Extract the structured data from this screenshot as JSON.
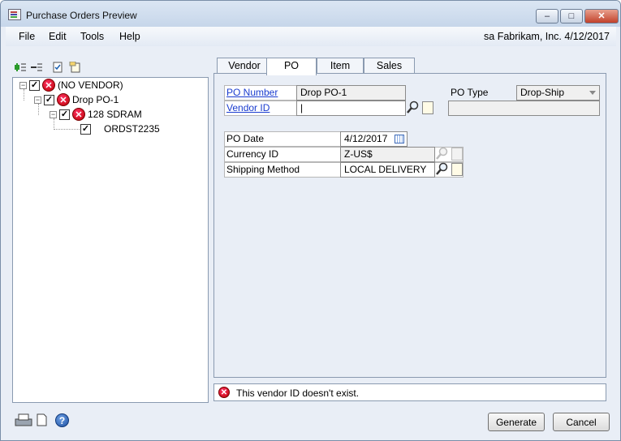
{
  "window": {
    "title": "Purchase Orders Preview"
  },
  "menu": {
    "items": [
      "File",
      "Edit",
      "Tools",
      "Help"
    ],
    "user_info": "sa  Fabrikam, Inc.  4/12/2017"
  },
  "tree": {
    "rows": [
      {
        "label": "(NO VENDOR)",
        "checked": true,
        "error": true
      },
      {
        "label": "Drop PO-1",
        "checked": true,
        "error": true
      },
      {
        "label": "128 SDRAM",
        "checked": true,
        "error": true
      },
      {
        "label": "ORDST2235",
        "checked": true,
        "error": false
      }
    ]
  },
  "tabs": [
    "Vendor",
    "PO",
    "Item",
    "Sales"
  ],
  "active_tab": "PO",
  "po_form": {
    "po_number_label": "PO Number",
    "po_number_value": "Drop PO-1",
    "vendor_id_label": "Vendor ID",
    "vendor_id_value": "|",
    "po_type_label": "PO Type",
    "po_type_value": "Drop-Ship",
    "po_date_label": "PO Date",
    "po_date_value": "4/12/2017",
    "currency_id_label": "Currency ID",
    "currency_id_value": "Z-US$",
    "shipping_method_label": "Shipping Method",
    "shipping_method_value": "LOCAL DELIVERY"
  },
  "status": {
    "message": "This vendor ID doesn't exist."
  },
  "buttons": {
    "generate": "Generate",
    "cancel": "Cancel"
  },
  "icons": {
    "error": "error-x-icon",
    "lookup": "magnifier-icon",
    "new": "new-document-icon",
    "calendar": "calendar-icon",
    "help": "help-icon"
  }
}
